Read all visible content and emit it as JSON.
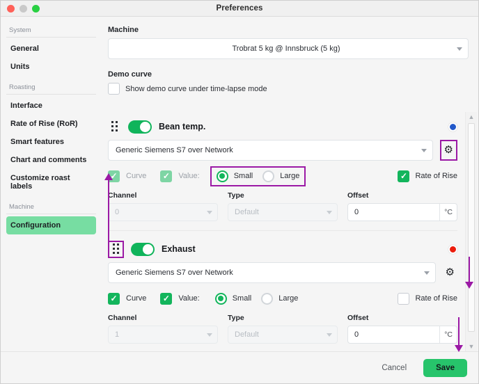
{
  "window": {
    "title": "Preferences",
    "traffic_lights": [
      "close-red",
      "minimize-gray",
      "zoom-green"
    ]
  },
  "sidebar": {
    "groups": [
      {
        "label": "System",
        "items": [
          {
            "label": "General",
            "active": false
          },
          {
            "label": "Units",
            "active": false
          }
        ]
      },
      {
        "label": "Roasting",
        "items": [
          {
            "label": "Interface",
            "active": false
          },
          {
            "label": "Rate of Rise (RoR)",
            "active": false
          },
          {
            "label": "Smart features",
            "active": false
          },
          {
            "label": "Chart and comments",
            "active": false
          },
          {
            "label": "Customize roast labels",
            "active": false
          }
        ]
      },
      {
        "label": "Machine",
        "items": [
          {
            "label": "Configuration",
            "active": true
          }
        ]
      }
    ]
  },
  "main": {
    "machine": {
      "label": "Machine",
      "selected": "Trobrat 5 kg @ Innsbruck (5 kg)"
    },
    "demo_curve": {
      "label": "Demo curve",
      "checkbox_label": "Show demo curve under time-lapse mode",
      "checked": false
    }
  },
  "channels": [
    {
      "name": "Bean temp.",
      "enabled": true,
      "indicator_color": "#2258c9",
      "device": "Generic Siemens S7 over Network",
      "curve": {
        "label": "Curve",
        "checked": true,
        "disabled": true
      },
      "value": {
        "label": "Value:",
        "checked": true,
        "disabled": true
      },
      "size": {
        "small_label": "Small",
        "large_label": "Large",
        "selected": "Small"
      },
      "rate_of_rise": {
        "label": "Rate of Rise",
        "checked": true
      },
      "channel": {
        "label": "Channel",
        "value": "0"
      },
      "type": {
        "label": "Type",
        "value": "Default"
      },
      "offset": {
        "label": "Offset",
        "value": "0",
        "unit": "°C"
      }
    },
    {
      "name": "Exhaust",
      "enabled": true,
      "indicator_color": "#eb1c0c",
      "device": "Generic Siemens S7 over Network",
      "curve": {
        "label": "Curve",
        "checked": true,
        "disabled": false
      },
      "value": {
        "label": "Value:",
        "checked": true,
        "disabled": false
      },
      "size": {
        "small_label": "Small",
        "large_label": "Large",
        "selected": "Small"
      },
      "rate_of_rise": {
        "label": "Rate of Rise",
        "checked": false
      },
      "channel": {
        "label": "Channel",
        "value": "1"
      },
      "type": {
        "label": "Type",
        "value": "Default"
      },
      "offset": {
        "label": "Offset",
        "value": "0",
        "unit": "°C"
      }
    }
  ],
  "footer": {
    "cancel_label": "Cancel",
    "save_label": "Save"
  },
  "annotations": {
    "highlight_color": "#9b19a5",
    "items": [
      "drag-handle-exhaust-box",
      "gear-bean-temp-box",
      "size-radio-group-box",
      "arrow-up-drag-to-beantemp",
      "arrow-down-scrollbar",
      "arrow-down-to-save"
    ]
  }
}
